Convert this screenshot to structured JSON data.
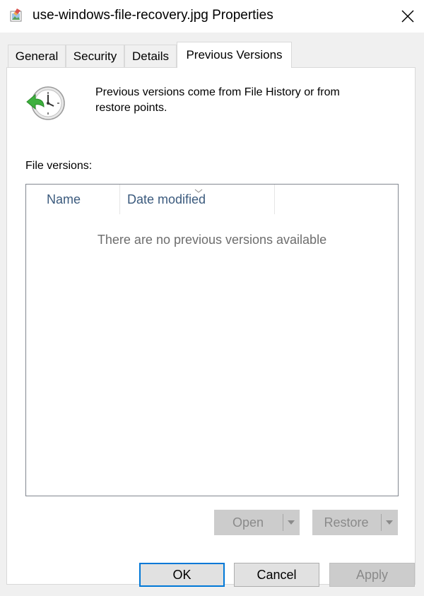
{
  "window": {
    "title": "use-windows-file-recovery.jpg Properties",
    "icon": "image-file-icon",
    "close_icon": "close-icon"
  },
  "tabs": [
    {
      "label": "General",
      "active": false
    },
    {
      "label": "Security",
      "active": false
    },
    {
      "label": "Details",
      "active": false
    },
    {
      "label": "Previous Versions",
      "active": true
    }
  ],
  "panel": {
    "icon": "restore-clock-icon",
    "info_text": "Previous versions come from File History or from restore points.",
    "versions_label": "File versions:",
    "list": {
      "columns": [
        "Name",
        "Date modified"
      ],
      "sorted_column": "Date modified",
      "sort_icon": "sort-chevron-icon",
      "empty_message": "There are no previous versions available",
      "rows": []
    },
    "open_button": {
      "label": "Open",
      "enabled": false
    },
    "restore_button": {
      "label": "Restore",
      "enabled": false
    }
  },
  "footer": {
    "ok_label": "OK",
    "cancel_label": "Cancel",
    "apply_label": "Apply",
    "apply_enabled": false
  },
  "colors": {
    "accent": "#0078d7",
    "column_header_text": "#3b5a7d",
    "dialog_background": "#f0f0f0"
  }
}
